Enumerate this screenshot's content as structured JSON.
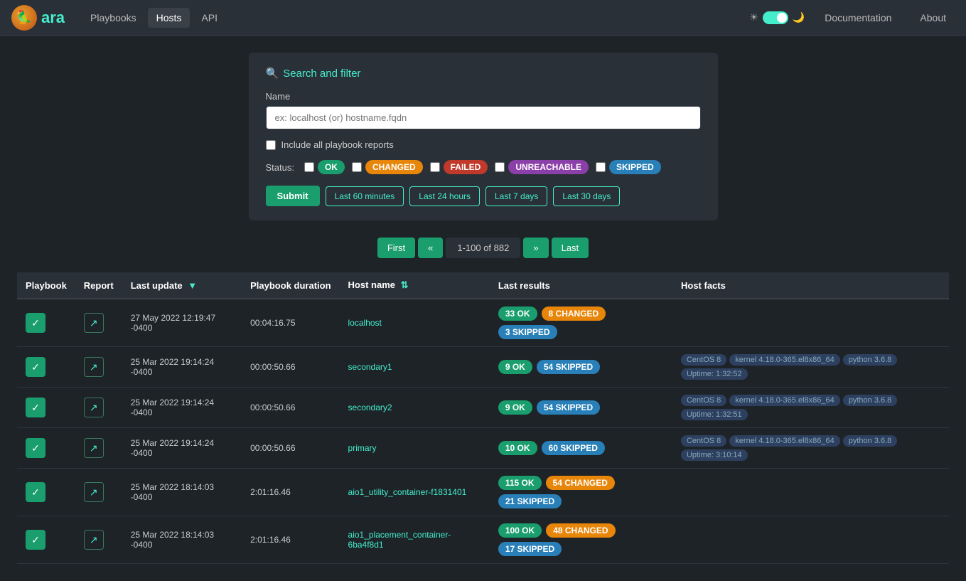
{
  "navbar": {
    "logo_text": "ara",
    "links": [
      {
        "label": "Playbooks",
        "active": false
      },
      {
        "label": "Hosts",
        "active": true
      },
      {
        "label": "API",
        "active": false
      }
    ],
    "right_links": [
      {
        "label": "Documentation"
      },
      {
        "label": "About"
      }
    ]
  },
  "search_panel": {
    "title": "Search and filter",
    "name_label": "Name",
    "name_placeholder": "ex: localhost (or) hostname.fqdn",
    "include_label": "Include all playbook reports",
    "status_label": "Status:",
    "statuses": [
      {
        "label": "OK",
        "class": "badge-ok"
      },
      {
        "label": "CHANGED",
        "class": "badge-changed"
      },
      {
        "label": "FAILED",
        "class": "badge-failed"
      },
      {
        "label": "UNREACHABLE",
        "class": "badge-unreachable"
      },
      {
        "label": "SKIPPED",
        "class": "badge-skipped"
      }
    ],
    "submit_label": "Submit",
    "time_buttons": [
      {
        "label": "Last 60 minutes"
      },
      {
        "label": "Last 24 hours"
      },
      {
        "label": "Last 7 days"
      },
      {
        "label": "Last 30 days"
      }
    ]
  },
  "pagination": {
    "first": "First",
    "prev": "«",
    "info": "1-100 of 882",
    "next": "»",
    "last": "Last"
  },
  "table": {
    "columns": [
      {
        "label": "Playbook"
      },
      {
        "label": "Report"
      },
      {
        "label": "Last update",
        "sortable": true
      },
      {
        "label": "Playbook duration"
      },
      {
        "label": "Host name",
        "sortable": true
      },
      {
        "label": "Last results"
      },
      {
        "label": "Host facts"
      }
    ],
    "rows": [
      {
        "last_update": "27 May 2022 12:19:47 -0400",
        "duration": "00:04:16.75",
        "host_name": "localhost",
        "results": [
          {
            "label": "33 OK",
            "class": "badge-ok"
          },
          {
            "label": "8 CHANGED",
            "class": "badge-changed"
          },
          {
            "label": "3 SKIPPED",
            "class": "badge-skipped"
          }
        ],
        "facts": []
      },
      {
        "last_update": "25 Mar 2022 19:14:24 -0400",
        "duration": "00:00:50.66",
        "host_name": "secondary1",
        "results": [
          {
            "label": "9 OK",
            "class": "badge-ok"
          },
          {
            "label": "54 SKIPPED",
            "class": "badge-skipped"
          }
        ],
        "facts": [
          "CentOS 8",
          "kernel 4.18.0-365.el8x86_64",
          "python 3.6.8",
          "Uptime: 1:32:52"
        ]
      },
      {
        "last_update": "25 Mar 2022 19:14:24 -0400",
        "duration": "00:00:50.66",
        "host_name": "secondary2",
        "results": [
          {
            "label": "9 OK",
            "class": "badge-ok"
          },
          {
            "label": "54 SKIPPED",
            "class": "badge-skipped"
          }
        ],
        "facts": [
          "CentOS 8",
          "kernel 4.18.0-365.el8x86_64",
          "python 3.6.8",
          "Uptime: 1:32:51"
        ]
      },
      {
        "last_update": "25 Mar 2022 19:14:24 -0400",
        "duration": "00:00:50.66",
        "host_name": "primary",
        "results": [
          {
            "label": "10 OK",
            "class": "badge-ok"
          },
          {
            "label": "60 SKIPPED",
            "class": "badge-skipped"
          }
        ],
        "facts": [
          "CentOS 8",
          "kernel 4.18.0-365.el8x86_64",
          "python 3.6.8",
          "Uptime: 3:10:14"
        ]
      },
      {
        "last_update": "25 Mar 2022 18:14:03 -0400",
        "duration": "2:01:16.46",
        "host_name": "aio1_utility_container-f1831401",
        "results": [
          {
            "label": "115 OK",
            "class": "badge-ok"
          },
          {
            "label": "54 CHANGED",
            "class": "badge-changed"
          },
          {
            "label": "21 SKIPPED",
            "class": "badge-skipped"
          }
        ],
        "facts": []
      },
      {
        "last_update": "25 Mar 2022 18:14:03 -0400",
        "duration": "2:01:16.46",
        "host_name": "aio1_placement_container-6ba4f8d1",
        "results": [
          {
            "label": "100 OK",
            "class": "badge-ok"
          },
          {
            "label": "48 CHANGED",
            "class": "badge-changed"
          },
          {
            "label": "17 SKIPPED",
            "class": "badge-skipped"
          }
        ],
        "facts": []
      }
    ]
  }
}
